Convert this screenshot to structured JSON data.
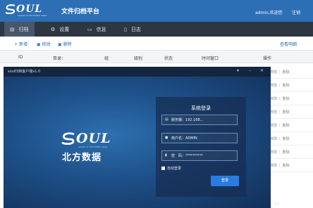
{
  "header": {
    "logo_word": "OUL",
    "logo_sub": "spread of information wave",
    "title": "文件归档平台",
    "user": "admin,欢迎您",
    "logout": "注销"
  },
  "nav": {
    "tabs": [
      {
        "label": "归档",
        "icon": "archive-icon"
      },
      {
        "label": "设置",
        "icon": "gear-icon"
      },
      {
        "label": "信息",
        "icon": "message-icon"
      },
      {
        "label": "日志",
        "icon": "log-icon"
      }
    ],
    "active_index": 0
  },
  "toolbar": {
    "add": "新增",
    "edit": "修改",
    "delete": "删除",
    "help": "查看明细"
  },
  "table": {
    "headers": [
      "ID",
      "目录：",
      "组",
      "级别",
      "状态",
      "时间窗口",
      "操作"
    ],
    "row_actions": {
      "a": "修改",
      "b": "删除"
    },
    "row_count": 8
  },
  "pager": "‹ ›",
  "client": {
    "title": "soul归档客户端v1.0",
    "brand_word": "OUL",
    "brand_sub": "spread of information wave",
    "brand_cn": "北方数据",
    "login": {
      "title": "系统登录",
      "server_value": "服务器：192.168...",
      "user_value": "用户名：ADMIN",
      "password_value": "密　码：**********",
      "auto_login": "自动登录",
      "submit": "登录"
    }
  },
  "colors": {
    "header_blue": "#2c6fb5",
    "nav_dark": "#2d3641",
    "login_button": "#2a7be0"
  }
}
